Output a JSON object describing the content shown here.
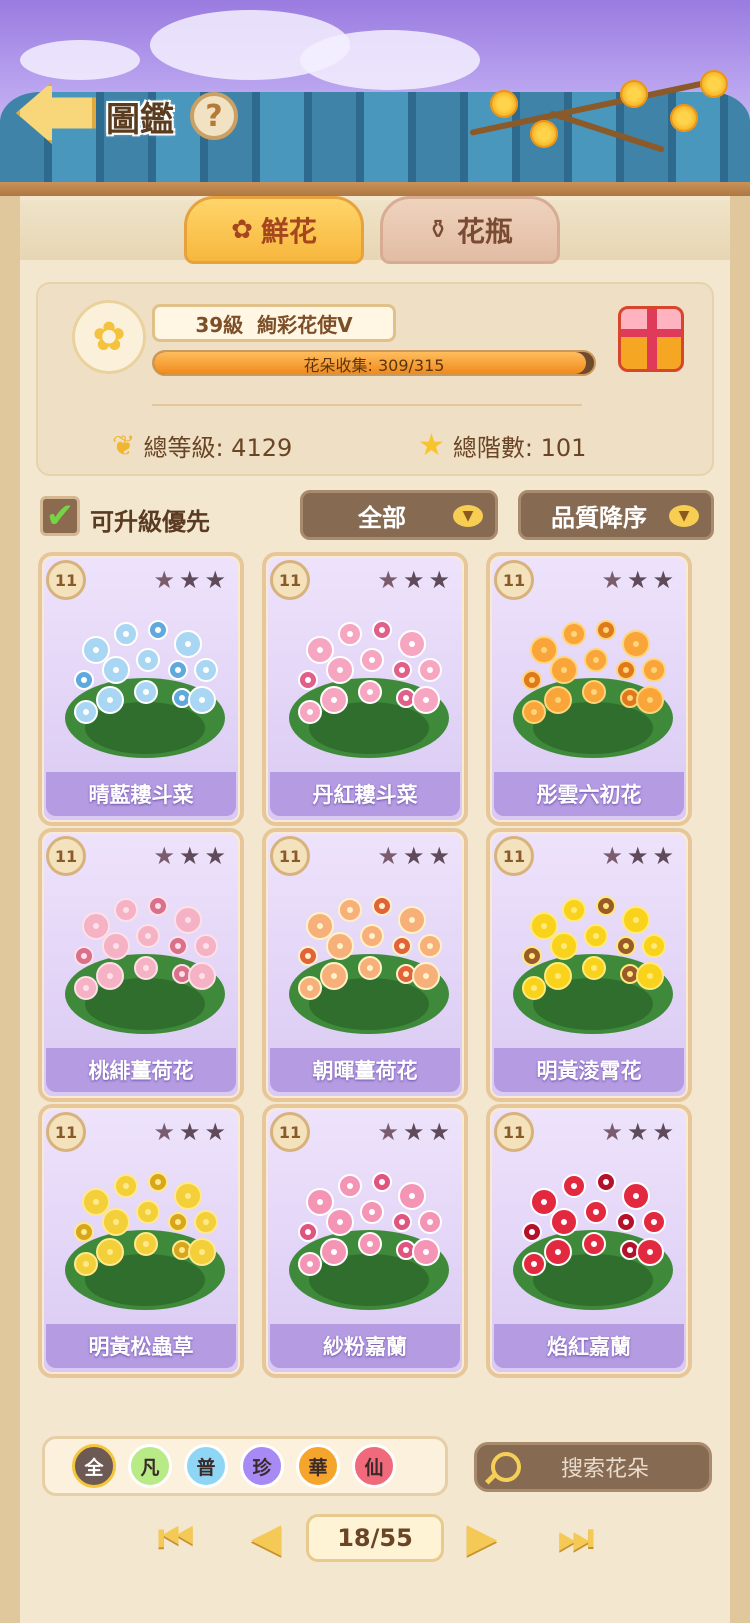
{
  "header": {
    "title": "圖鑑",
    "help_glyph": "?"
  },
  "tabs": [
    {
      "label": "鮮花",
      "icon": "rose-icon",
      "active": true
    },
    {
      "label": "花瓶",
      "icon": "vase-icon",
      "active": false
    }
  ],
  "profile": {
    "level": "39級",
    "rank_title": "絢彩花使V",
    "collection_text": "花朵收集: 309/315",
    "collection_progress": 0.981,
    "total_level": "總等級: 4129",
    "total_stars": "總階數: 101"
  },
  "filters": {
    "upgrade_first_label": "可升級優先",
    "upgrade_first_checked": true,
    "category_label": "全部",
    "sort_label": "品質降序"
  },
  "cards": [
    {
      "level": "11",
      "name": "晴藍耬斗菜",
      "stars_lit": 1,
      "palette": [
        "#a9d6f2",
        "#ffffff",
        "#5fa9dc"
      ]
    },
    {
      "level": "11",
      "name": "丹紅耬斗菜",
      "stars_lit": 1,
      "palette": [
        "#f6a6c0",
        "#ffffff",
        "#e0608a"
      ]
    },
    {
      "level": "11",
      "name": "彤雲六初花",
      "stars_lit": 1,
      "palette": [
        "#f9a53a",
        "#ffd57a",
        "#e0781c"
      ]
    },
    {
      "level": "11",
      "name": "桃緋薑荷花",
      "stars_lit": 1,
      "palette": [
        "#f5b2c4",
        "#fde0e8",
        "#d9708c"
      ]
    },
    {
      "level": "11",
      "name": "朝暉薑荷花",
      "stars_lit": 1,
      "palette": [
        "#f7b07a",
        "#fff2c8",
        "#e2623a"
      ]
    },
    {
      "level": "11",
      "name": "明黃淩霄花",
      "stars_lit": 1,
      "palette": [
        "#f9d21c",
        "#ffe97a",
        "#9a5a2a"
      ]
    },
    {
      "level": "11",
      "name": "明黃松蟲草",
      "stars_lit": 1,
      "palette": [
        "#f3cf3a",
        "#ffe98a",
        "#d8a61c"
      ]
    },
    {
      "level": "11",
      "name": "紗粉嘉蘭",
      "stars_lit": 1,
      "palette": [
        "#f595b6",
        "#ffffff",
        "#e0557f"
      ]
    },
    {
      "level": "11",
      "name": "焰紅嘉蘭",
      "stars_lit": 1,
      "palette": [
        "#e2293f",
        "#ffffff",
        "#b3122a"
      ]
    }
  ],
  "quality": [
    {
      "label": "全",
      "key": "all"
    },
    {
      "label": "凡",
      "key": "common"
    },
    {
      "label": "普",
      "key": "normal"
    },
    {
      "label": "珍",
      "key": "rare"
    },
    {
      "label": "華",
      "key": "epic"
    },
    {
      "label": "仙",
      "key": "legend"
    }
  ],
  "search": {
    "placeholder": "搜索花朵"
  },
  "pagination": {
    "page_text": "18/55"
  },
  "colors": {
    "accent": "#f7b73d",
    "card_bg": "#d9c9f3",
    "panel_brown": "#876a52"
  }
}
